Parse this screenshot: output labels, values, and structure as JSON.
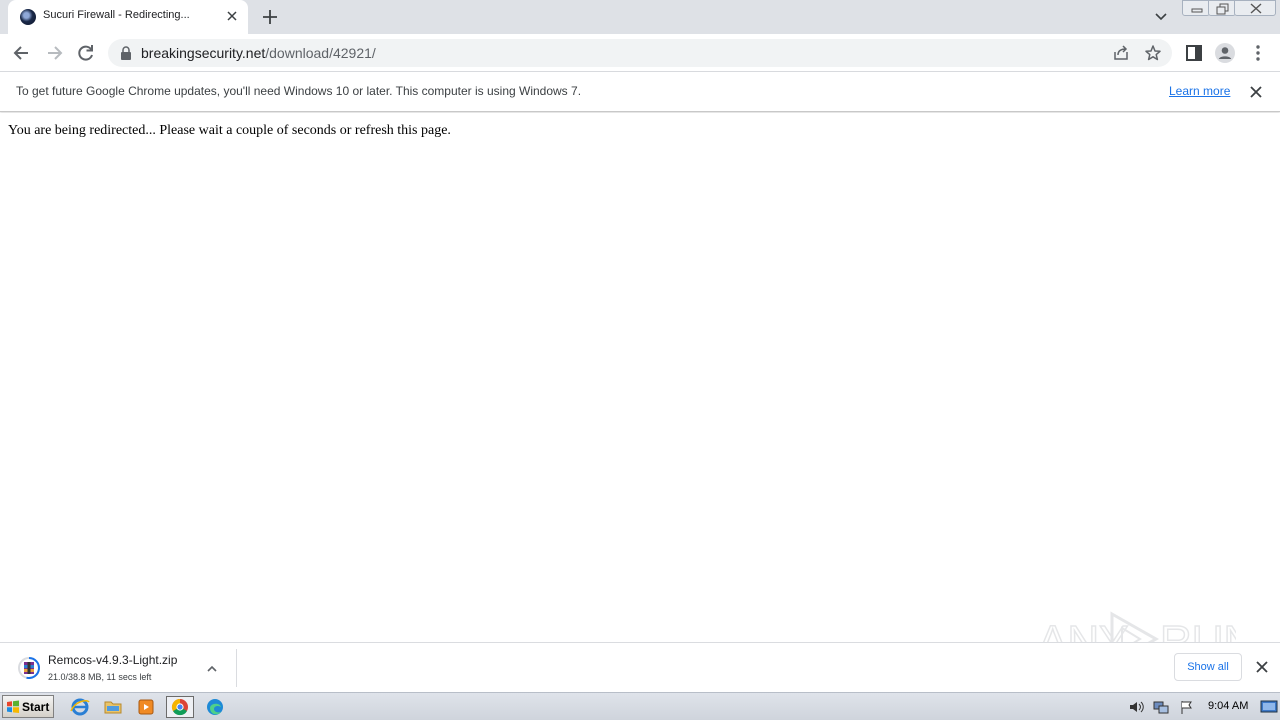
{
  "tab": {
    "title": "Sucuri Firewall - Redirecting...",
    "favicon_icon": "sucuri-globe-icon"
  },
  "toolbar": {
    "url_domain": "breakingsecurity.net",
    "url_path": "/download/42921/"
  },
  "infobar": {
    "message": "To get future Google Chrome updates, you'll need Windows 10 or later. This computer is using Windows 7.",
    "link_label": "Learn more"
  },
  "page": {
    "message": "You are being redirected... Please wait a couple of seconds or refresh this page."
  },
  "download": {
    "filename": "Remcos-v4.9.3-Light.zip",
    "status": "21.0/38.8 MB, 11 secs left",
    "progress": 0.54,
    "show_all_label": "Show all"
  },
  "taskbar": {
    "start_label": "Start",
    "apps": [
      "internet-explorer-icon",
      "file-explorer-icon",
      "media-player-icon",
      "chrome-icon",
      "edge-icon"
    ],
    "clock": "9:04 AM"
  },
  "watermark": {
    "text": "ANY RUN"
  },
  "colors": {
    "accent": "#1a73e8",
    "tabstrip": "#dee1e6",
    "omnibox": "#f1f3f4"
  }
}
